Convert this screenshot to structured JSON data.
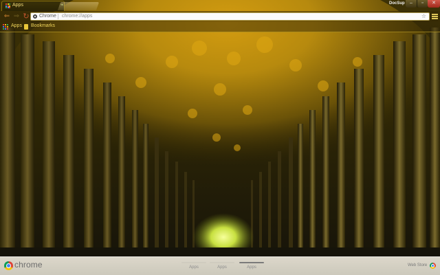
{
  "tab": {
    "title": "Apps"
  },
  "window": {
    "profile_name": "DocSup"
  },
  "toolbar": {
    "omnibox_label": "Chrome",
    "url": "chrome://apps"
  },
  "bookmarks": {
    "apps_label": "Apps",
    "bookmarks_label": "Bookmarks"
  },
  "footer": {
    "brand": "chrome",
    "pages": [
      {
        "label": "Apps",
        "active": false
      },
      {
        "label": "Apps",
        "active": false
      },
      {
        "label": "Apps",
        "active": true
      }
    ],
    "webstore_label": "Web Store"
  },
  "icons": {
    "back": "back-arrow-icon",
    "forward": "forward-arrow-icon",
    "reload": "reload-icon",
    "star": "star-icon",
    "menu": "hamburger-menu-icon",
    "apps": "apps-grid-icon",
    "bookmark": "bookmark-folder-icon"
  },
  "colors": {
    "theme_gold": "#d8b62c",
    "wallpaper_dark": "#1b1607",
    "close_red": "#c13f2f"
  }
}
